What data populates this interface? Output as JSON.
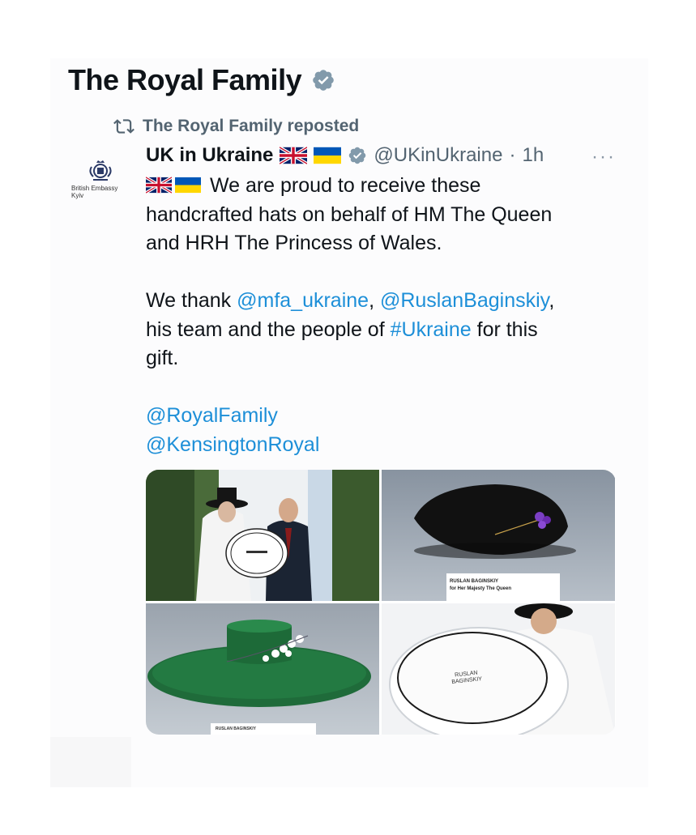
{
  "profile": {
    "name": "The Royal Family",
    "verified_icon": "verified-badge-icon"
  },
  "repost": {
    "icon": "repost-icon",
    "text": "The Royal Family reposted"
  },
  "tweet": {
    "avatar_text_line1": "British Embassy",
    "avatar_text_line2": "Kyiv",
    "author": "UK in Ukraine",
    "handle": "@UKinUkraine",
    "separator": "·",
    "time": "1h",
    "more_label": "···",
    "text_line1": "We are proud to receive these",
    "text_line2": "handcrafted hats on behalf of HM The Queen",
    "text_line3": "and HRH The Princess of Wales.",
    "text_line4_a": "We thank ",
    "mention_mfa": "@mfa_ukraine",
    "comma1": ", ",
    "mention_ruslan": "@RuslanBaginskiy",
    "comma2": ",",
    "text_line5_a": "his team and the people of ",
    "hashtag_ukraine": "#Ukraine",
    "text_line5_b": " for this",
    "text_line6": "gift.",
    "mention_royal": "@RoyalFamily",
    "mention_kensington": "@KensingtonRoyal"
  },
  "media": {
    "photo2_label_line1": "RUSLAN BAGINSKIY",
    "photo2_label_line2": "for Her Majesty The Queen",
    "photo3_label": "RUSLAN BAGINSKIY",
    "photo4_box_line1": "RUSLAN",
    "photo4_box_line2": "BAGINSKIY"
  },
  "colors": {
    "link": "#1d8fd8",
    "muted": "#536471",
    "verified": "#829aab"
  }
}
